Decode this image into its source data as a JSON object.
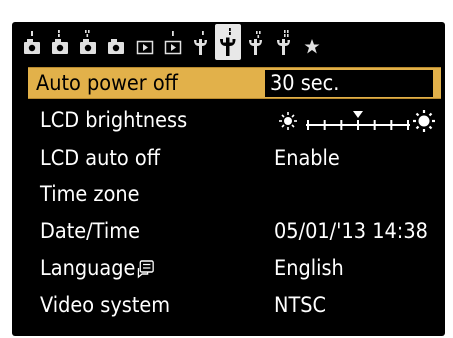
{
  "tabs": [
    {
      "name": "shooting-1",
      "icon": "camera-icon",
      "dots": 1
    },
    {
      "name": "shooting-2",
      "icon": "camera-icon",
      "dots": 2
    },
    {
      "name": "shooting-3",
      "icon": "camera-icon",
      "dots": 3
    },
    {
      "name": "shooting-4",
      "icon": "camera-icon",
      "dots": 0
    },
    {
      "name": "playback-1",
      "icon": "playback-icon",
      "dots": 0
    },
    {
      "name": "playback-2",
      "icon": "playback-icon",
      "dots": 1
    },
    {
      "name": "setup-1",
      "icon": "wrench-icon",
      "dots": 1
    },
    {
      "name": "setup-2",
      "icon": "wrench-icon",
      "dots": 2,
      "active": true
    },
    {
      "name": "setup-3",
      "icon": "wrench-icon",
      "dots": 3
    },
    {
      "name": "setup-4",
      "icon": "wrench-icon",
      "dots": 4
    },
    {
      "name": "my-menu",
      "icon": "star-icon",
      "dots": 0
    }
  ],
  "menu": {
    "items": [
      {
        "label": "Auto power off",
        "value": "30 sec.",
        "selected": true
      },
      {
        "label": "LCD brightness",
        "value": "",
        "brightness_level": 4,
        "brightness_max": 7
      },
      {
        "label": "LCD auto off",
        "value": "Enable"
      },
      {
        "label": "Time zone",
        "value": ""
      },
      {
        "label": "Date/Time",
        "value": "05/01/'13 14:38"
      },
      {
        "label": "Language",
        "value": "English"
      },
      {
        "label": "Video system",
        "value": "NTSC"
      }
    ]
  },
  "colors": {
    "background": "#000000",
    "highlight": "#e2b14a",
    "text": "#ffffff",
    "active_tab": "#e8e8e8"
  }
}
